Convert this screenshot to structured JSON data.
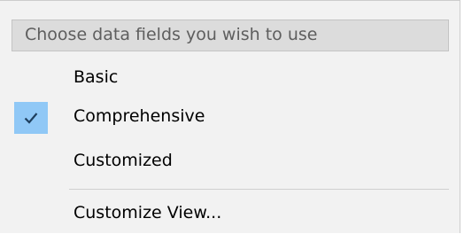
{
  "menu": {
    "header": "Choose data fields you wish to use",
    "items": [
      {
        "label": "Basic",
        "checked": false
      },
      {
        "label": "Comprehensive",
        "checked": true
      },
      {
        "label": "Customized",
        "checked": false
      }
    ],
    "customize_label": "Customize View...",
    "check_icon": "checkmark-icon",
    "check_highlight_color": "#90c8f6"
  }
}
